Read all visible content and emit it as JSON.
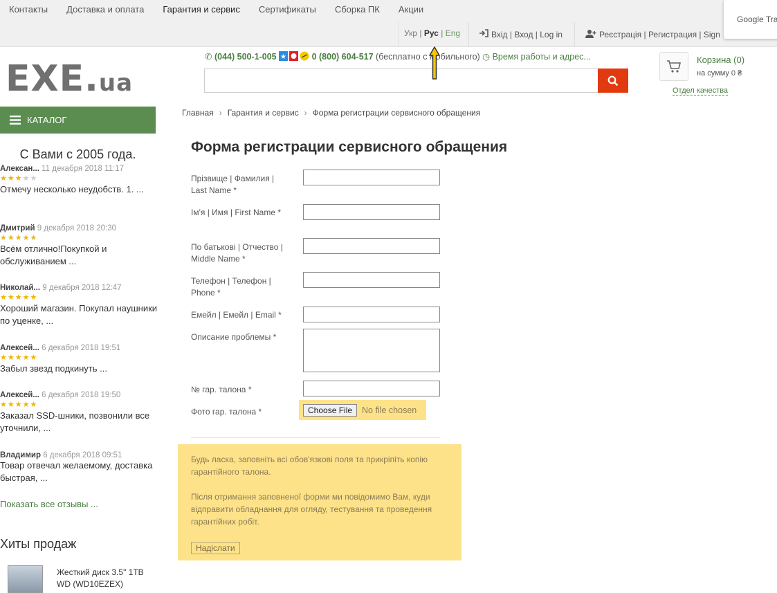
{
  "topnav": [
    "Контакты",
    "Доставка и оплата",
    "Гарантия и сервис",
    "Сертификаты",
    "Сборка ПК",
    "Акции"
  ],
  "lang": {
    "ukr": "Укр",
    "rus": "Рус",
    "eng": "Eng",
    "sep": "|"
  },
  "auth": {
    "login": "Вхід | Вход | Log in",
    "register": "Реєстрація | Регистрация | Sign"
  },
  "google_translate": "Google Tra",
  "logo": {
    "main": "EXE",
    "dot": ".",
    "tld": "ua"
  },
  "contacts": {
    "phone1": "(044) 500-1-005",
    "phone2": "0 (800) 604-517",
    "phone2_note": "(бесплатно с мобильного)",
    "hours": "Время работы и адрес..."
  },
  "cart": {
    "title": "Корзина (0)",
    "sum": "на сумму 0 ₴",
    "quality": "Отдел качества"
  },
  "sidebar": {
    "catalog": "КАТАЛОГ",
    "since": "С Вами с 2005 года.",
    "reviews": [
      {
        "author": "Алексан...",
        "date": "11 декабря 2018 11:17",
        "stars": 3,
        "text": "Отмечу несколько неудобств. 1. ..."
      },
      {
        "author": "Дмитрий",
        "date": "9 декабря 2018 20:30",
        "stars": 5,
        "text": "Всём отлично!Покупкой и обслуживанием ..."
      },
      {
        "author": "Николай...",
        "date": "9 декабря 2018 12:47",
        "stars": 5,
        "text": "Хороший магазин. Покупал наушники по уценке, ..."
      },
      {
        "author": "Алексей...",
        "date": "6 декабря 2018 19:51",
        "stars": 5,
        "text": "Забыл звезд подкинуть ..."
      },
      {
        "author": "Алексей...",
        "date": "6 декабря 2018 19:50",
        "stars": 5,
        "text": "Заказал SSD-шники, позвонили все уточнили, ..."
      },
      {
        "author": "Владимир",
        "date": "6 декабря 2018 09:51",
        "stars": 0,
        "text": "Товар отвечал желаемому, доставка быстрая, ..."
      }
    ],
    "show_all": "Показать все отзывы ...",
    "hits_title": "Хиты продаж",
    "hit_product": "Жесткий диск 3.5\" 1TB WD (WD10EZEX)"
  },
  "breadcrumb": [
    "Главная",
    "Гарантия и сервис",
    "Форма регистрации сервисного обращения"
  ],
  "breadcrumb_sep": "›",
  "page_title": "Форма регистрации сервисного обращения",
  "form": {
    "surname": "Прізвище | Фамилия | Last Name *",
    "name": "Ім'я | Имя | First Name *",
    "middle": "По батькові | Отчество | Middle Name *",
    "phone": "Телефон | Телефон | Phone *",
    "email": "Емейл | Емейл | Email *",
    "problem": "Описание проблемы *",
    "coupon": "№ гар. талона *",
    "photo": "Фото гар. талона *",
    "choose_file": "Choose File",
    "no_file": "No file chosen"
  },
  "notice": {
    "p1": "Будь ласка, заповніть всі обов'язкові поля та прикріпіть копію гарантійного талона.",
    "p2": "Після отримання заповненої форми ми повідомимо Вам, куди відправити обладнання для огляду, тестування та проведення гарантійних робіт.",
    "submit": "Надіслати"
  }
}
